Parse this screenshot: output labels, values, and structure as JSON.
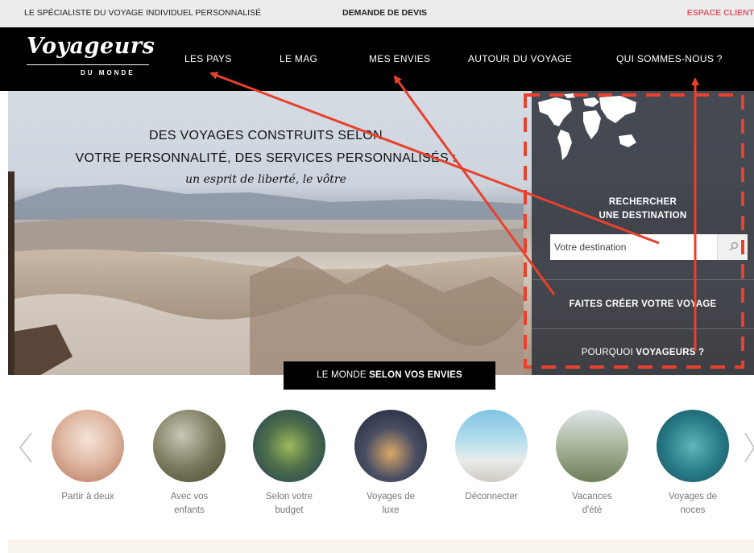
{
  "topbar": {
    "tagline": "LE SPÉCIALISTE DU VOYAGE INDIVIDUEL PERSONNALISÉ",
    "devis": "DEMANDE DE DEVIS",
    "espace": "ESPACE CLIENT"
  },
  "logo": {
    "main": "Voyageurs",
    "sub": "DU MONDE"
  },
  "nav": [
    {
      "label": "LES PAYS"
    },
    {
      "label": "LE MAG"
    },
    {
      "label": "MES ENVIES"
    },
    {
      "label": "AUTOUR DU VOYAGE"
    },
    {
      "label": "QUI SOMMES-NOUS ?"
    }
  ],
  "hero": {
    "line1": "DES VOYAGES CONSTRUITS SELON",
    "line2": "VOTRE PERSONNALITÉ, DES SERVICES PERSONNALISÉS :",
    "slogan": "un esprit de liberté, le vôtre"
  },
  "search": {
    "title_line1": "RECHERCHER",
    "title_line2": "UNE DESTINATION",
    "placeholder": "Votre destination",
    "search_icon": "magnifier-icon"
  },
  "panel_links": [
    {
      "label": "FAITES CRÉER VOTRE VOYAGE"
    },
    {
      "label_a": "POURQUOI ",
      "label_b": "VOYAGEURS ?"
    }
  ],
  "world_banner": {
    "part1": "LE MONDE ",
    "part2": "SELON VOS ENVIES"
  },
  "categories": [
    {
      "line1": "Partir à deux",
      "line2": ""
    },
    {
      "line1": "Avec vos",
      "line2": "enfants"
    },
    {
      "line1": "Selon votre",
      "line2": "budget"
    },
    {
      "line1": "Voyages de",
      "line2": "luxe"
    },
    {
      "line1": "Déconnecter",
      "line2": ""
    },
    {
      "line1": "Vacances",
      "line2": "d'été"
    },
    {
      "line1": "Voyages de",
      "line2": "noces"
    }
  ],
  "colors": {
    "nav_bg": "#000000",
    "topbar_bg": "#ececec",
    "accent_pink": "#e05a6a",
    "annotation_red": "#e8412e"
  },
  "icons": [
    "world-map-icon",
    "magnifier-icon",
    "chevron-left-icon",
    "chevron-right-icon"
  ]
}
